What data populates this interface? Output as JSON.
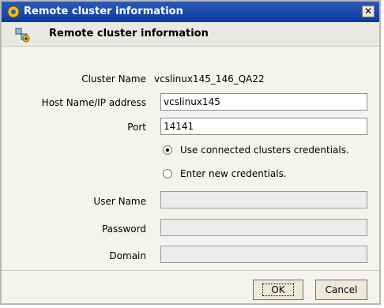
{
  "window": {
    "title": "Remote cluster information",
    "close_glyph": "✕"
  },
  "header": {
    "title": "Remote cluster information",
    "icon": "cluster-add-icon"
  },
  "form": {
    "cluster_name_label": "Cluster Name",
    "cluster_name_value": "vcslinux145_146_QA22",
    "host_label": "Host Name/IP address",
    "host_value": "vcslinux145",
    "port_label": "Port",
    "port_value": "14141",
    "radio_connected_label": "Use connected clusters credentials.",
    "radio_new_label": "Enter new credentials.",
    "selected_credentials": "connected",
    "user_label": "User Name",
    "user_value": "",
    "password_label": "Password",
    "password_value": "",
    "domain_label": "Domain",
    "domain_value": ""
  },
  "buttons": {
    "ok": "OK",
    "cancel": "Cancel"
  }
}
